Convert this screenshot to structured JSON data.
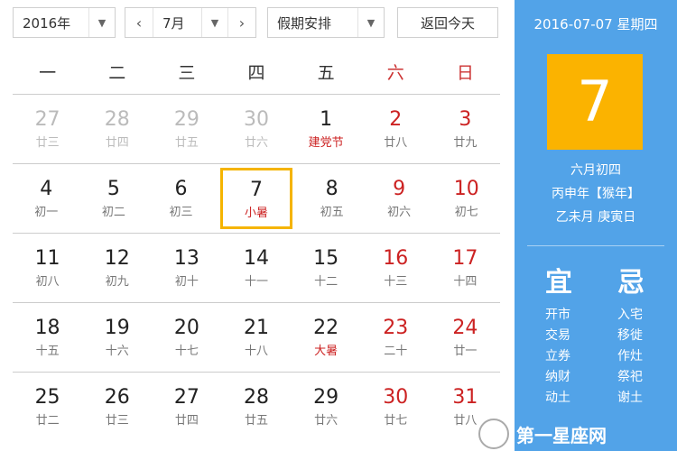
{
  "toolbar": {
    "year": "2016年",
    "month": "7月",
    "holiday": "假期安排",
    "today_btn": "返回今天",
    "prev": "‹",
    "next": "›"
  },
  "weekdays": [
    "一",
    "二",
    "三",
    "四",
    "五",
    "六",
    "日"
  ],
  "weeks": [
    [
      {
        "d": "27",
        "l": "廿三"
      },
      {
        "d": "28",
        "l": "廿四"
      },
      {
        "d": "29",
        "l": "廿五"
      },
      {
        "d": "30",
        "l": "廿六"
      },
      {
        "d": "1",
        "l": "建党节"
      },
      {
        "d": "2",
        "l": "廿八"
      },
      {
        "d": "3",
        "l": "廿九"
      }
    ],
    [
      {
        "d": "4",
        "l": "初一"
      },
      {
        "d": "5",
        "l": "初二"
      },
      {
        "d": "6",
        "l": "初三"
      },
      {
        "d": "7",
        "l": "小暑"
      },
      {
        "d": "8",
        "l": "初五"
      },
      {
        "d": "9",
        "l": "初六"
      },
      {
        "d": "10",
        "l": "初七"
      }
    ],
    [
      {
        "d": "11",
        "l": "初八"
      },
      {
        "d": "12",
        "l": "初九"
      },
      {
        "d": "13",
        "l": "初十"
      },
      {
        "d": "14",
        "l": "十一"
      },
      {
        "d": "15",
        "l": "十二"
      },
      {
        "d": "16",
        "l": "十三"
      },
      {
        "d": "17",
        "l": "十四"
      }
    ],
    [
      {
        "d": "18",
        "l": "十五"
      },
      {
        "d": "19",
        "l": "十六"
      },
      {
        "d": "20",
        "l": "十七"
      },
      {
        "d": "21",
        "l": "十八"
      },
      {
        "d": "22",
        "l": "大暑"
      },
      {
        "d": "23",
        "l": "二十"
      },
      {
        "d": "24",
        "l": "廿一"
      }
    ],
    [
      {
        "d": "25",
        "l": "廿二"
      },
      {
        "d": "26",
        "l": "廿三"
      },
      {
        "d": "27",
        "l": "廿四"
      },
      {
        "d": "28",
        "l": "廿五"
      },
      {
        "d": "29",
        "l": "廿六"
      },
      {
        "d": "30",
        "l": "廿七"
      },
      {
        "d": "31",
        "l": "廿八"
      }
    ]
  ],
  "side": {
    "date": "2016-07-07 星期四",
    "day": "7",
    "lunar1": "六月初四",
    "lunar2": "丙申年【猴年】",
    "lunar3": "乙未月 庚寅日",
    "yi": "宜",
    "ji": "忌",
    "yi_items": [
      "开市",
      "交易",
      "立券",
      "纳财",
      "动土"
    ],
    "ji_items": [
      "入宅",
      "移徙",
      "作灶",
      "祭祀",
      "谢土"
    ]
  },
  "watermark": "第一星座网",
  "colors": {
    "accent": "#52a3e8",
    "today": "#fbb300",
    "weekend": "#cc2222"
  }
}
